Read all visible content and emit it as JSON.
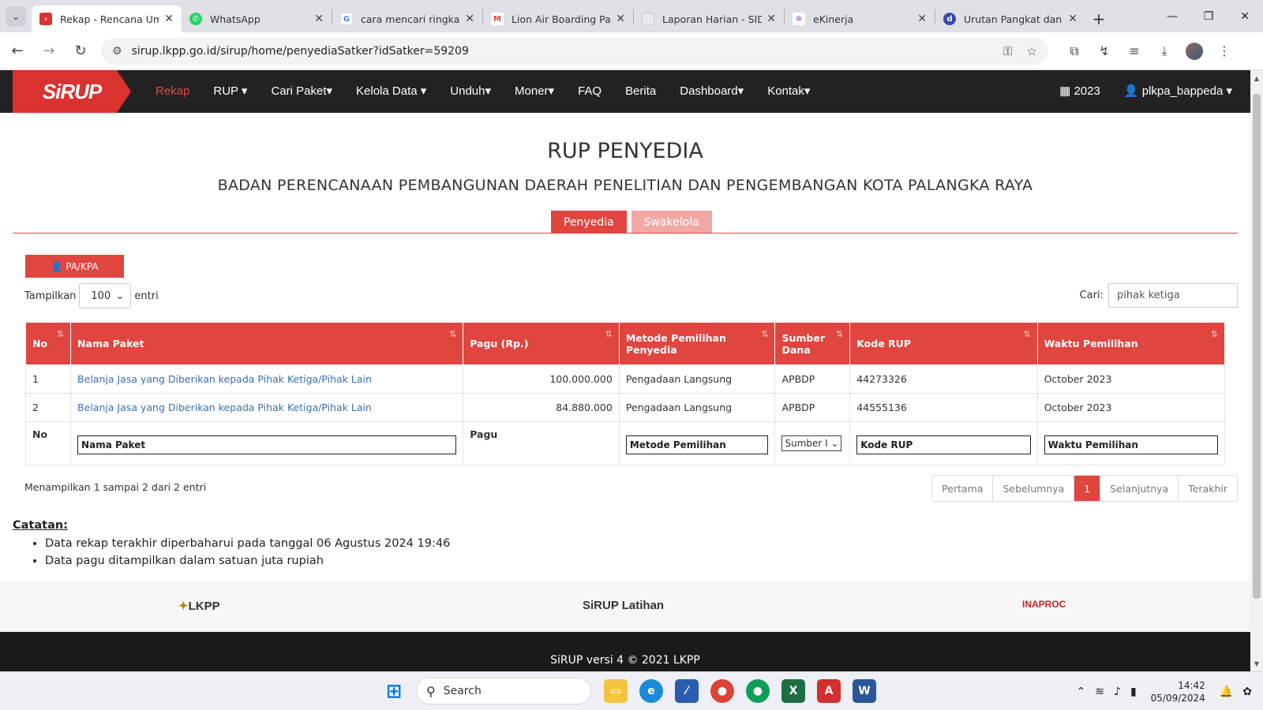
{
  "browser": {
    "tabs": [
      {
        "title": "Rekap - Rencana Um",
        "color": "#d9322f",
        "glyph": "›",
        "active": true
      },
      {
        "title": "WhatsApp",
        "color": "#25d366",
        "glyph": "W",
        "active": false
      },
      {
        "title": "cara mencari ringkas",
        "color": "#4285f4",
        "glyph": "G",
        "active": false
      },
      {
        "title": "Lion Air Boarding Pa",
        "color": "#ea4335",
        "glyph": "M",
        "active": false
      },
      {
        "title": "Laporan Harian - SID",
        "color": "#cfd8dc",
        "glyph": "",
        "active": false
      },
      {
        "title": "eKinerja",
        "color": "#7e57c2",
        "glyph": "e",
        "active": false
      },
      {
        "title": "Urutan Pangkat dan",
        "color": "#3949ab",
        "glyph": "d",
        "active": false
      }
    ],
    "url": "sirup.lkpp.go.id/sirup/home/penyediaSatker?idSatker=59209"
  },
  "nav": {
    "logo": "SiRUP",
    "items": [
      "Rekap",
      "RUP ▾",
      "Cari Paket▾",
      "Kelola Data ▾",
      "Unduh▾",
      "Moner▾",
      "FAQ",
      "Berita",
      "Dashboard▾",
      "Kontak▾"
    ],
    "year": "2023",
    "user": "plkpa_bappeda ▾"
  },
  "page": {
    "title": "RUP PENYEDIA",
    "subtitle": "BADAN PERENCANAAN PEMBANGUNAN DAERAH PENELITIAN DAN PENGEMBANGAN KOTA PALANGKA RAYA",
    "tab_penyedia": "Penyedia",
    "tab_swakelola": "Swakelola",
    "pa_button": "PA/KPA",
    "show_label": "Tampilkan",
    "show_value": "100",
    "entries_label": "entri",
    "search_label": "Cari:",
    "search_value": "pihak ketiga"
  },
  "table": {
    "headers": [
      "No",
      "Nama Paket",
      "Pagu (Rp.)",
      "Metode Pemilihan Penyedia",
      "Sumber Dana",
      "Kode RUP",
      "Waktu Pemilihan"
    ],
    "rows": [
      [
        "1",
        "Belanja Jasa yang Diberikan kepada Pihak Ketiga/Pihak Lain",
        "100.000.000",
        "Pengadaan Langsung",
        "APBDP",
        "44273326",
        "October 2023"
      ],
      [
        "2",
        "Belanja Jasa yang Diberikan kepada Pihak Ketiga/Pihak Lain",
        "84.880.000",
        "Pengadaan Langsung",
        "APBDP",
        "44555136",
        "October 2023"
      ]
    ],
    "filter": {
      "no": "No",
      "nama": "Nama Paket",
      "pagu": "Pagu",
      "metode": "Metode Pemilihan",
      "sumber": "Sumber I",
      "kode": "Kode RUP",
      "waktu": "Waktu Pemilihan"
    }
  },
  "info": "Menampilkan 1 sampai 2 dari 2 entri",
  "pager": [
    "Pertama",
    "Sebelumnya",
    "1",
    "Selanjutnya",
    "Terakhir"
  ],
  "notes": {
    "title": "Catatan:",
    "items": [
      "Data rekap terakhir diperbaharui pada tanggal 06 Agustus 2024 19:46",
      "Data pagu ditampilkan dalam satuan juta rupiah"
    ]
  },
  "footer": {
    "logo_left": "LKPP",
    "logo_center": "SiRUP Latihan",
    "logo_right": "INAPROC",
    "copyright": "SiRUP versi 4 © 2021 LKPP"
  },
  "taskbar": {
    "search": "Search",
    "time": "14:42",
    "date": "05/09/2024"
  },
  "colors": {
    "accent": "#e0453f",
    "nav_bg": "#222222",
    "link": "#3a6fb0"
  }
}
